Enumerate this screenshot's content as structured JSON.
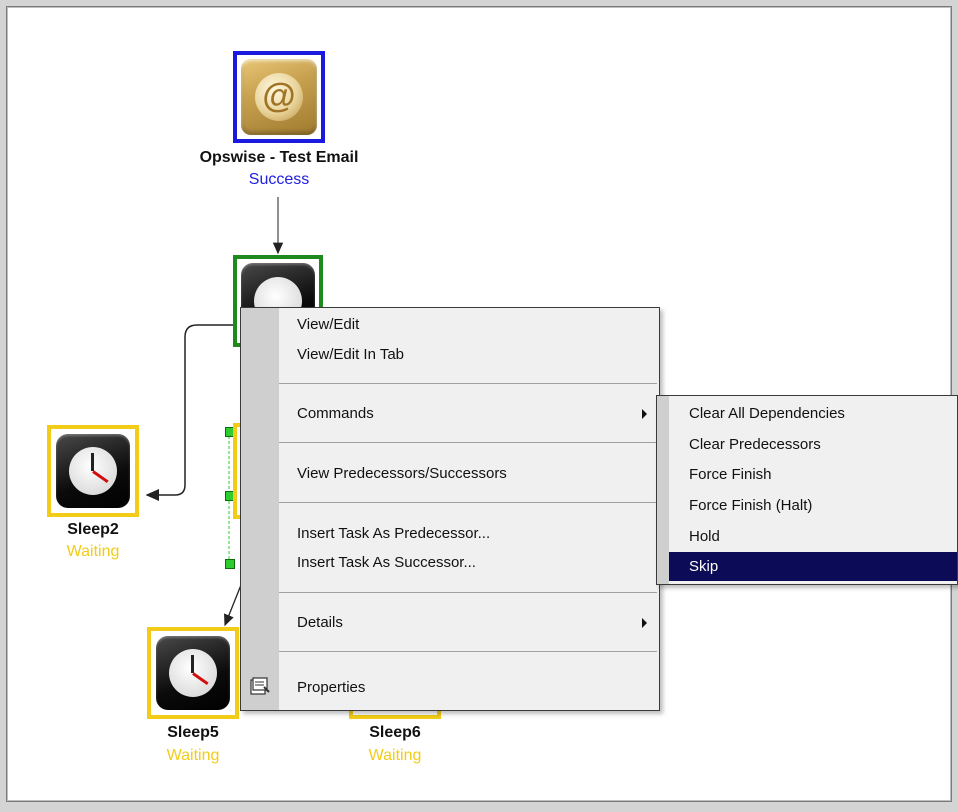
{
  "nodes": {
    "email": {
      "name": "Opswise - Test Email",
      "status": "Success"
    },
    "sleep2": {
      "name": "Sleep2",
      "status": "Waiting"
    },
    "sleep5": {
      "name": "Sleep5",
      "status": "Waiting"
    },
    "sleep6": {
      "name": "Sleep6",
      "status": "Waiting"
    }
  },
  "context_menu": {
    "view_edit": "View/Edit",
    "view_edit_tab": "View/Edit In Tab",
    "commands": "Commands",
    "view_pred_succ": "View Predecessors/Successors",
    "insert_pred": "Insert Task As Predecessor...",
    "insert_succ": "Insert Task As Successor...",
    "details": "Details",
    "properties": "Properties"
  },
  "commands_submenu": {
    "items": [
      "Clear All Dependencies",
      "Clear Predecessors",
      "Force Finish",
      "Force Finish (Halt)",
      "Hold",
      "Skip"
    ],
    "selected": "Skip"
  },
  "colors": {
    "success_border": "#1a1adf",
    "running_border": "#1e8a1e",
    "waiting_border": "#f2cc16",
    "selection_bg": "#0b0b57"
  }
}
